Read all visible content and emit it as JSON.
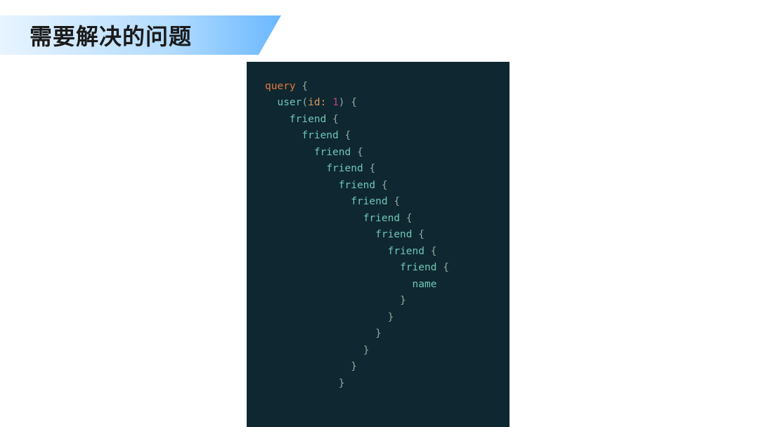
{
  "slide": {
    "title": "需要解决的问题"
  },
  "code": {
    "keyword": "query",
    "rootFn": "user",
    "argName": "id",
    "argColon": ":",
    "argValue": "1",
    "friend": "friend",
    "leaf": "name",
    "openBrace": "{",
    "closeBrace": "}",
    "openParen": "(",
    "closeParen": ")",
    "space": " "
  }
}
